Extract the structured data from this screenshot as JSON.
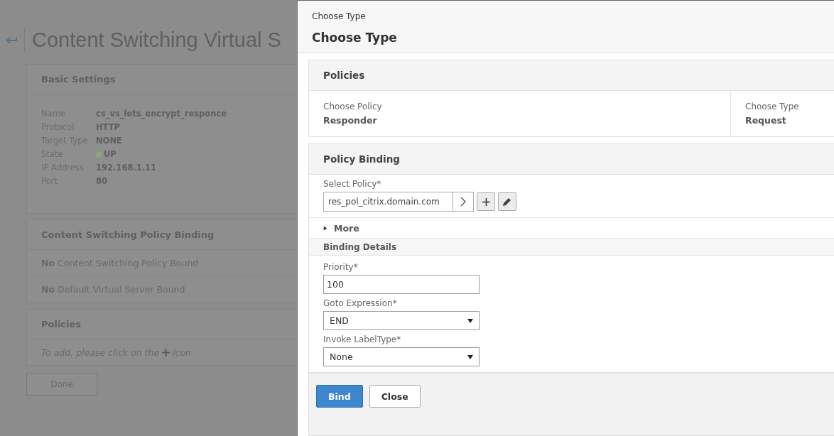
{
  "background_page": {
    "title": "Content Switching Virtual S",
    "basic_settings": {
      "heading": "Basic Settings",
      "details": [
        {
          "label": "Name",
          "value": "cs_vs_lets_encrypt_responce"
        },
        {
          "label": "Protocol",
          "value": "HTTP"
        },
        {
          "label": "Target Type",
          "value": "NONE"
        },
        {
          "label": "State",
          "value": "UP",
          "color": "#8ca67a"
        },
        {
          "label": "IP Address",
          "value": "192.168.1.11"
        },
        {
          "label": "Port",
          "value": "80"
        }
      ]
    },
    "policy_binding": {
      "heading": "Content Switching Policy Binding",
      "rows": [
        "**No** Content Switching Policy Bound",
        "**No** Default Virtual Server Bound"
      ]
    },
    "policies": {
      "heading": "Policies",
      "hint_before": "To add, please click on the",
      "hint_after": "icon"
    },
    "done_button": "Done"
  },
  "panel": {
    "breadcrumb": "Choose Type",
    "title": "Choose Type",
    "policies": {
      "heading": "Policies",
      "fields": [
        {
          "label": "Choose Policy",
          "value": "Responder"
        },
        {
          "label": "Choose Type",
          "value": "Request"
        }
      ]
    },
    "policy_binding": {
      "heading": "Policy Binding",
      "select_policy": {
        "label": "Select Policy*",
        "value": "res_pol_citrix.domain.com"
      },
      "more": {
        "label": "More",
        "expanded": false
      },
      "binding_details": {
        "heading": "Binding Details",
        "fields": [
          {
            "kind": "text",
            "label": "Priority*",
            "value": "100"
          },
          {
            "kind": "select",
            "label": "Goto Expression*",
            "value": "END"
          },
          {
            "kind": "select",
            "label": "Invoke LabelType*",
            "value": "None"
          }
        ]
      }
    },
    "buttons": [
      {
        "label": "Bind",
        "primary": true
      },
      {
        "label": "Close",
        "primary": false
      }
    ]
  }
}
